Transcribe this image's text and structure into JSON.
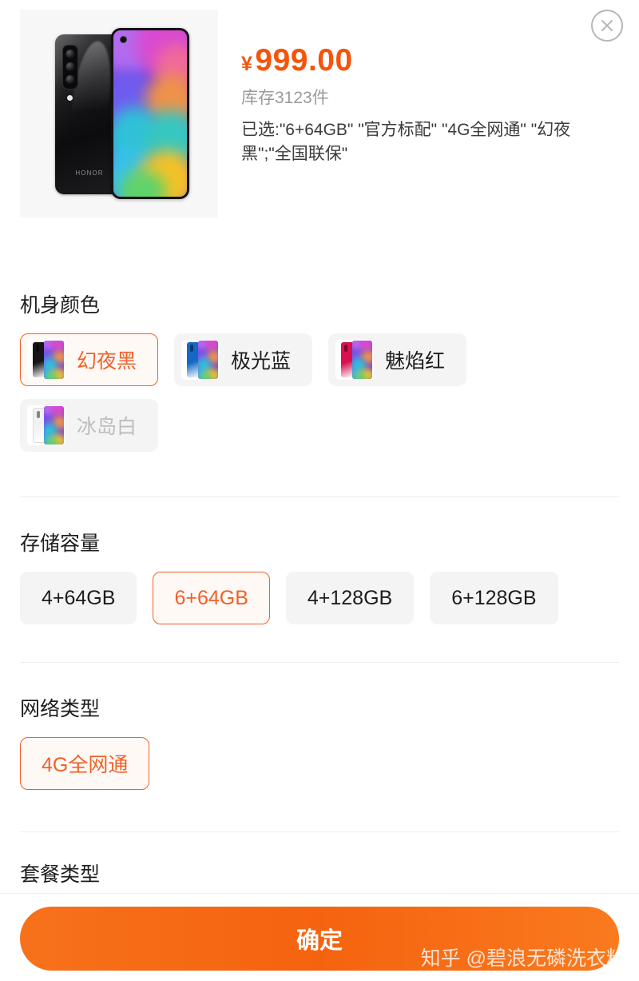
{
  "product": {
    "image_alt": "HONOR Play 3 phone, black back and gradient screen",
    "brand_mark": "HONOR",
    "currency_symbol": "¥",
    "price": "999.00",
    "stock_text": "库存3123件",
    "chosen_text": "已选:\"6+64GB\" \"官方标配\" \"4G全网通\" \"幻夜黑\";\"全国联保\""
  },
  "close_label": "×",
  "sections": {
    "color": {
      "title": "机身颜色",
      "options": [
        {
          "label": "幻夜黑",
          "selected": true,
          "disabled": false,
          "swatch": "#151517"
        },
        {
          "label": "极光蓝",
          "selected": false,
          "disabled": false,
          "swatch": "#1568c4"
        },
        {
          "label": "魅焰红",
          "selected": false,
          "disabled": false,
          "swatch": "#d81050"
        },
        {
          "label": "冰岛白",
          "selected": false,
          "disabled": true,
          "swatch": "#f2f2f2"
        }
      ]
    },
    "storage": {
      "title": "存储容量",
      "options": [
        {
          "label": "4+64GB",
          "selected": false
        },
        {
          "label": "6+64GB",
          "selected": true
        },
        {
          "label": "4+128GB",
          "selected": false
        },
        {
          "label": "6+128GB",
          "selected": false
        }
      ]
    },
    "network": {
      "title": "网络类型",
      "options": [
        {
          "label": "4G全网通",
          "selected": true
        }
      ]
    },
    "package": {
      "title": "套餐类型"
    }
  },
  "footer": {
    "confirm_label": "确定",
    "watermark": "知乎 @碧浪无磷洗衣粉"
  },
  "colors": {
    "accent": "#f0612a",
    "price": "#f5540b",
    "button_orange": "#f5630f",
    "chip_bg": "#f4f4f4",
    "chip_selected_bg": "#fff9f5",
    "text_primary": "#1d1d1d",
    "text_muted": "#9a9a9a",
    "text_disabled": "#bdbdbd",
    "divider": "#ededed"
  }
}
